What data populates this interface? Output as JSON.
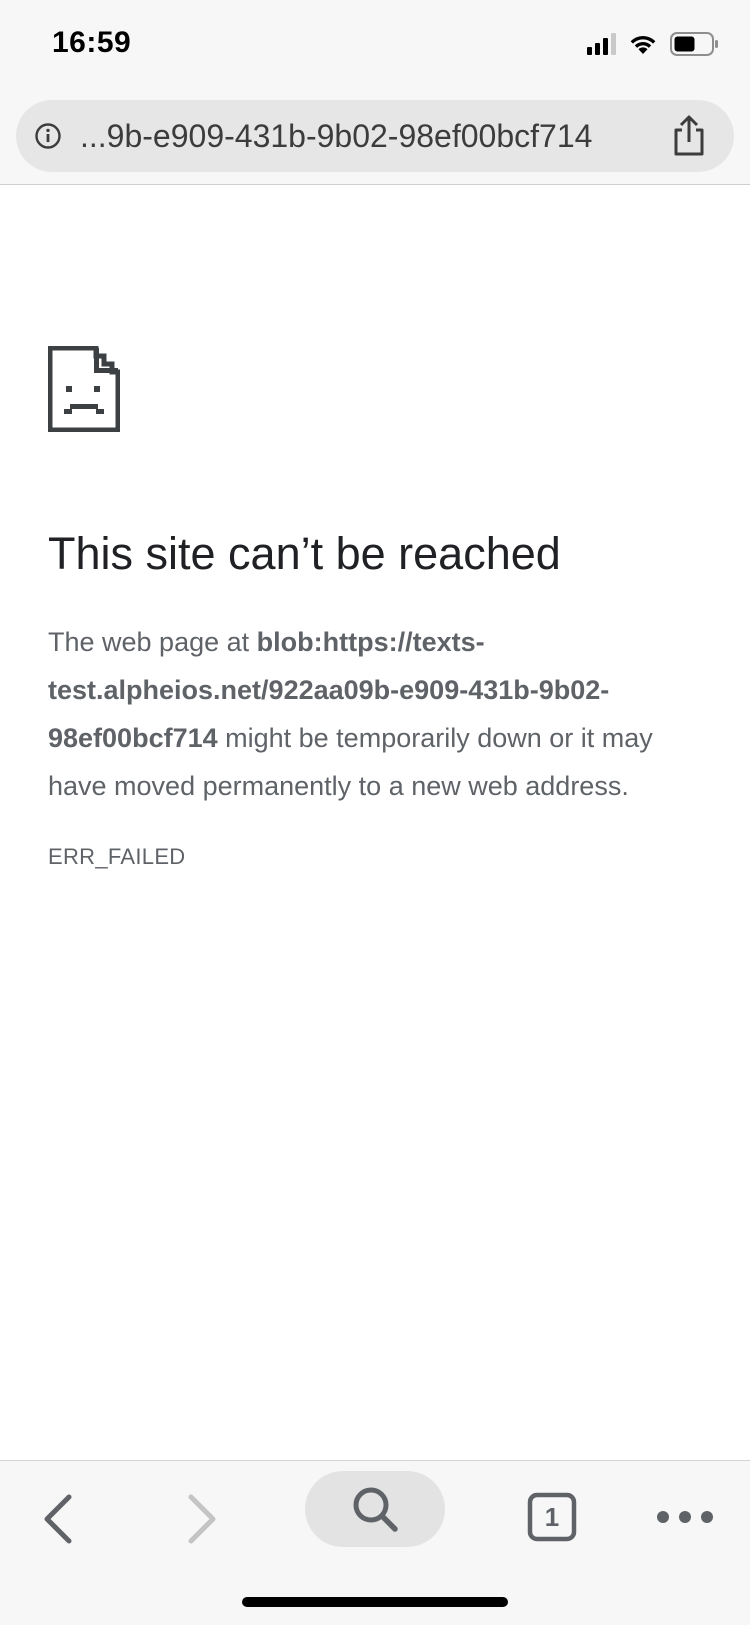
{
  "status_bar": {
    "time": "16:59"
  },
  "url_bar": {
    "url_text": "...9b-e909-431b-9b02-98ef00bcf714"
  },
  "error_page": {
    "title": "This site can’t be reached",
    "message_prefix": "The web page at ",
    "message_url": "blob:https://texts-test.alpheios.net/922aa09b-e909-431b-9b02-98ef00bcf714",
    "message_suffix": " might be temporarily down or it may have moved permanently to a new web address.",
    "error_code": "ERR_FAILED"
  },
  "toolbar": {
    "tab_count": "1"
  },
  "colors": {
    "bar_background": "#f7f7f7",
    "url_field": "#e6e6e6",
    "text_primary": "#202124",
    "text_secondary": "#5f6368",
    "icon_disabled": "#c4c4c4"
  },
  "icons": [
    "info-icon",
    "share-icon",
    "sad-page-icon",
    "back-icon",
    "forward-icon",
    "search-icon",
    "tab-switcher-icon",
    "more-icon",
    "signal-icon",
    "wifi-icon",
    "battery-icon"
  ]
}
